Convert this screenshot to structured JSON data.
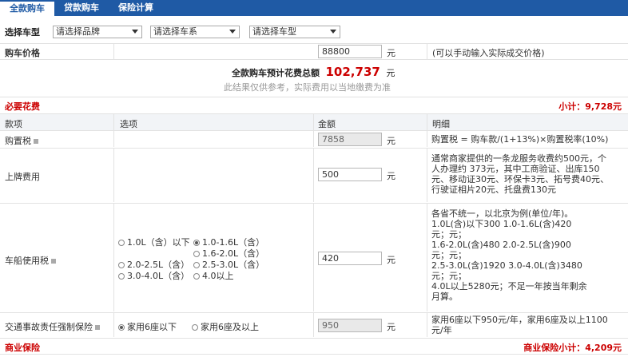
{
  "tabs": [
    {
      "label": "全款购车",
      "active": true
    },
    {
      "label": "贷款购车",
      "active": false
    },
    {
      "label": "保险计算",
      "active": false
    }
  ],
  "select_row": {
    "label": "选择车型",
    "brand": "请选择品牌",
    "series": "请选择车系",
    "model": "请选择车型"
  },
  "price_row": {
    "label": "购车价格",
    "value": "88800",
    "unit": "元",
    "hint": "(可以手动输入实际成交价格)"
  },
  "total": {
    "label": "全款购车预计花费总额",
    "value": "102,737",
    "unit": "元",
    "note": "此结果仅供参考，实际费用以当地缴费为准"
  },
  "required": {
    "title": "必要花费",
    "subtotal": "小计：9,728元"
  },
  "columns": {
    "item": "款项",
    "option": "选项",
    "amount": "金额",
    "detail": "明细"
  },
  "purchase_tax": {
    "label": "购置税",
    "value": "7858",
    "unit": "元",
    "detail": "购置税 = 购车款/(1+13%)×购置税率(10%)"
  },
  "plate_fee": {
    "label": "上牌费用",
    "value": "500",
    "unit": "元",
    "detail": [
      "通常商家提供的一条龙服务收费约500元，个",
      "人办理约 373元，其中工商验证、出库150",
      "元、移动证30元、环保卡3元、拓号费40元、",
      "行驶证相片20元、托盘费130元"
    ]
  },
  "vehicle_tax": {
    "label": "车船使用税",
    "value": "420",
    "unit": "元",
    "options": [
      "1.0L（含）以下",
      "1.0-1.6L（含）",
      "1.6-2.0L（含）",
      "2.0-2.5L（含）",
      "2.5-3.0L（含）",
      "3.0-4.0L（含）",
      "4.0以上"
    ],
    "detail": [
      "各省不统一，以北京为例(单位/年)。",
      "1.0L(含)以下300 1.0-1.6L(含)420",
      "元；元；",
      "1.6-2.0L(含)480 2.0-2.5L(含)900",
      "元；元；",
      "2.5-3.0L(含)1920 3.0-4.0L(含)3480",
      "元；元；",
      "4.0L以上5280元；不足一年按当年剩余",
      "月算。"
    ]
  },
  "traffic_insurance": {
    "label": "交通事故责任强制保险",
    "value": "950",
    "unit": "元",
    "options": [
      "家用6座以下",
      "家用6座及以上"
    ],
    "detail": [
      "家用6座以下950元/年，家用6座及以上1100",
      "元/年"
    ]
  },
  "commercial": {
    "title": "商业保险",
    "subtotal": "商业保险小计：4,209元"
  }
}
